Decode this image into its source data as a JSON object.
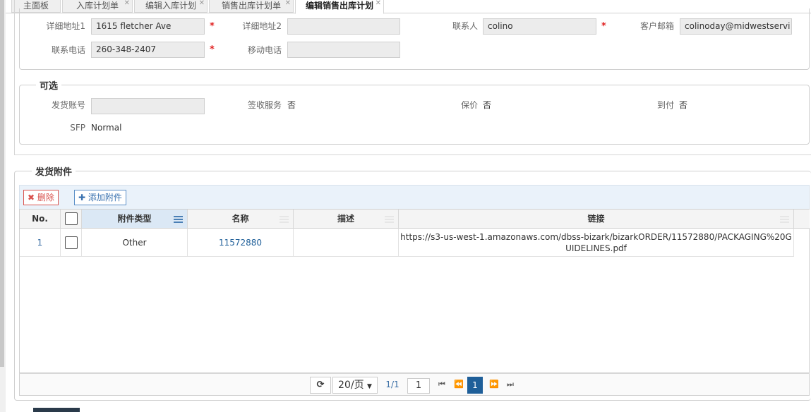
{
  "tabs": [
    {
      "label": "主面板"
    },
    {
      "label": "入库计划单"
    },
    {
      "label": "编辑入库计划"
    },
    {
      "label": "销售出库计划单"
    },
    {
      "label": "编辑销售出库计划"
    }
  ],
  "address": {
    "detail1_label": "详细地址1",
    "detail1_value": "1615 fletcher Ave",
    "detail2_label": "详细地址2",
    "detail2_value": "",
    "contact_label": "联系人",
    "contact_value": "colino",
    "email_label": "客户邮箱",
    "email_value": "colinoday@midwestservi",
    "phone_label": "联系电话",
    "phone_value": "260-348-2407",
    "mobile_label": "移动电话",
    "mobile_value": "",
    "required_mark": "*"
  },
  "optional": {
    "legend": "可选",
    "shipping_account_label": "发货账号",
    "shipping_account_value": "",
    "signature_label": "签收服务",
    "signature_value": "否",
    "insurance_label": "保价",
    "insurance_value": "否",
    "cod_label": "到付",
    "cod_value": "否",
    "sfp_label": "SFP",
    "sfp_value": "Normal"
  },
  "attachments": {
    "legend": "发货附件",
    "delete_label": "删除",
    "add_label": "添加附件",
    "columns": {
      "no": "No.",
      "type": "附件类型",
      "name": "名称",
      "desc": "描述",
      "link": "链接"
    },
    "rows": [
      {
        "no": "1",
        "type": "Other",
        "name": "11572880",
        "desc": "",
        "link": "https://s3-us-west-1.amazonaws.com/dbss-bizark/bizarkORDER/11572880/PACKAGING%20GUIDELINES.pdf"
      }
    ]
  },
  "pager": {
    "page_size": "20/页",
    "page_info": "1/1",
    "page_input": "1",
    "current_page": "1"
  },
  "colors": {
    "accent": "#1f5f99",
    "required": "#e02020",
    "delete": "#d9534f"
  }
}
